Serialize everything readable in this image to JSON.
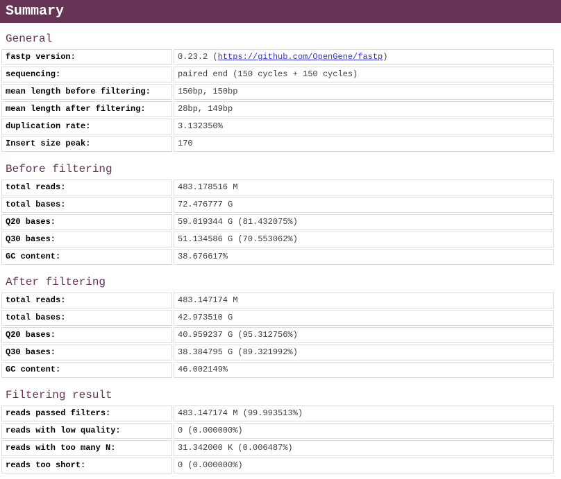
{
  "header": {
    "title": "Summary"
  },
  "colors": {
    "accent": "#663355",
    "header_text": "#ffffff",
    "table_border": "#dddddd",
    "link": "#3333cc",
    "label_text": "#000000",
    "value_text": "#3c3c3c",
    "page_bg": "#ffffff"
  },
  "sections": [
    {
      "id": "general",
      "title": "General",
      "rows": [
        {
          "label": "fastp version:",
          "value_prefix": "0.23.2 (",
          "link_text": "https://github.com/OpenGene/fastp",
          "value_suffix": ")"
        },
        {
          "label": "sequencing:",
          "value": "paired end (150 cycles + 150 cycles)"
        },
        {
          "label": "mean length before filtering:",
          "value": "150bp, 150bp"
        },
        {
          "label": "mean length after filtering:",
          "value": "28bp, 149bp"
        },
        {
          "label": "duplication rate:",
          "value": "3.132350%"
        },
        {
          "label": "Insert size peak:",
          "value": "170"
        }
      ]
    },
    {
      "id": "before-filtering",
      "title": "Before filtering",
      "rows": [
        {
          "label": "total reads:",
          "value": "483.178516 M"
        },
        {
          "label": "total bases:",
          "value": "72.476777 G"
        },
        {
          "label": "Q20 bases:",
          "value": "59.019344 G (81.432075%)"
        },
        {
          "label": "Q30 bases:",
          "value": "51.134586 G (70.553062%)"
        },
        {
          "label": "GC content:",
          "value": "38.676617%"
        }
      ]
    },
    {
      "id": "after-filtering",
      "title": "After filtering",
      "rows": [
        {
          "label": "total reads:",
          "value": "483.147174 M"
        },
        {
          "label": "total bases:",
          "value": "42.973510 G"
        },
        {
          "label": "Q20 bases:",
          "value": "40.959237 G (95.312756%)"
        },
        {
          "label": "Q30 bases:",
          "value": "38.384795 G (89.321992%)"
        },
        {
          "label": "GC content:",
          "value": "46.002149%"
        }
      ]
    },
    {
      "id": "filtering-result",
      "title": "Filtering result",
      "rows": [
        {
          "label": "reads passed filters:",
          "value": "483.147174 M (99.993513%)"
        },
        {
          "label": "reads with low quality:",
          "value": "0 (0.000000%)"
        },
        {
          "label": "reads with too many N:",
          "value": "31.342000 K (0.006487%)"
        },
        {
          "label": "reads too short:",
          "value": "0 (0.000000%)"
        }
      ]
    }
  ]
}
